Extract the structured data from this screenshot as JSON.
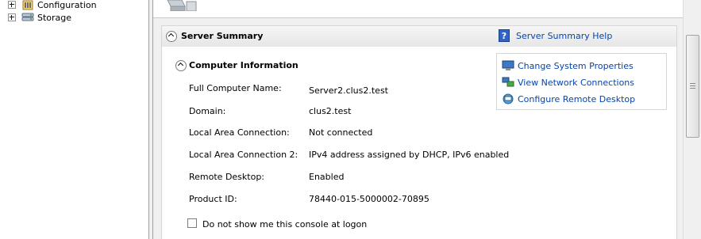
{
  "tree": {
    "items": [
      {
        "label": "Configuration",
        "icon": "configuration-icon"
      },
      {
        "label": "Storage",
        "icon": "storage-icon"
      }
    ]
  },
  "server_summary": {
    "title": "Server Summary",
    "help_link": "Server Summary Help"
  },
  "computer_information": {
    "title": "Computer Information",
    "actions": [
      {
        "label": "Change System Properties",
        "icon": "system-properties-icon"
      },
      {
        "label": "View Network Connections",
        "icon": "network-connections-icon"
      },
      {
        "label": "Configure Remote Desktop",
        "icon": "remote-desktop-icon"
      }
    ],
    "fields": [
      {
        "label": "Full Computer Name:",
        "value": "Server2.clus2.test"
      },
      {
        "label": "Domain:",
        "value": "clus2.test"
      },
      {
        "label": "Local Area Connection:",
        "value": "Not connected"
      },
      {
        "label": "Local Area Connection 2:",
        "value": "IPv4 address assigned by DHCP, IPv6 enabled"
      },
      {
        "label": "Remote Desktop:",
        "value": "Enabled"
      },
      {
        "label": "Product ID:",
        "value": "78440-015-5000002-70895"
      }
    ],
    "checkbox_label": "Do not show me this console at logon",
    "checkbox_checked": false
  },
  "colors": {
    "link": "#0645ad",
    "header_bg": "#e9e9e9"
  }
}
